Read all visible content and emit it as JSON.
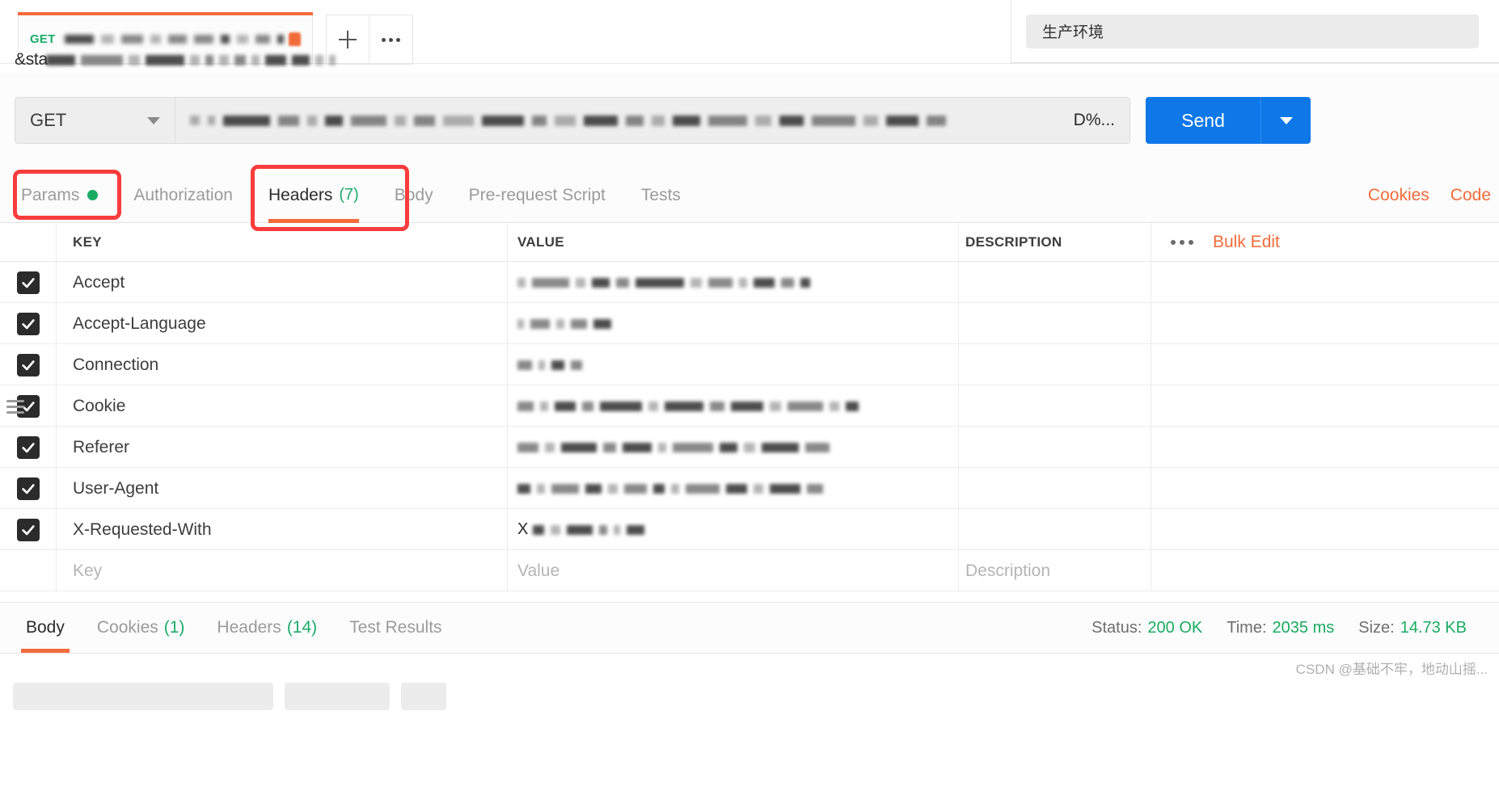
{
  "tabstrip": {
    "request_tab": {
      "method": "GET",
      "name_obscured": true
    },
    "new_tab_label": "+",
    "more_label": "•••"
  },
  "environment": {
    "selected": "生产环境"
  },
  "url_bar": {
    "method": "GET",
    "url_visible_tail": "D%...",
    "url_overflow_prefix": "&sta",
    "send_label": "Send"
  },
  "request_tabs": {
    "items": [
      {
        "label": "Params",
        "has_dot": true,
        "active": false
      },
      {
        "label": "Authorization",
        "active": false
      },
      {
        "label": "Headers",
        "count": "(7)",
        "active": true
      },
      {
        "label": "Body",
        "active": false
      },
      {
        "label": "Pre-request Script",
        "active": false
      },
      {
        "label": "Tests",
        "active": false
      }
    ],
    "right_links": [
      "Cookies",
      "Code"
    ]
  },
  "headers_table": {
    "columns": [
      "KEY",
      "VALUE",
      "DESCRIPTION"
    ],
    "bulk_edit_label": "Bulk Edit",
    "rows": [
      {
        "checked": true,
        "key": "Accept",
        "value_obscured": true,
        "description": ""
      },
      {
        "checked": true,
        "key": "Accept-Language",
        "value_obscured": true,
        "description": ""
      },
      {
        "checked": true,
        "key": "Connection",
        "value_obscured": true,
        "description": ""
      },
      {
        "checked": true,
        "key": "Cookie",
        "value_obscured": true,
        "description": "",
        "dragging": true
      },
      {
        "checked": true,
        "key": "Referer",
        "value_obscured": true,
        "description": ""
      },
      {
        "checked": true,
        "key": "User-Agent",
        "value_obscured": true,
        "description": ""
      },
      {
        "checked": true,
        "key": "X-Requested-With",
        "value_prefix": "X",
        "description": ""
      }
    ],
    "placeholder_row": {
      "key": "Key",
      "value": "Value",
      "description": "Description"
    }
  },
  "response": {
    "tabs": [
      {
        "label": "Body",
        "active": true
      },
      {
        "label": "Cookies",
        "count": "(1)",
        "active": false
      },
      {
        "label": "Headers",
        "count": "(14)",
        "active": false
      },
      {
        "label": "Test Results",
        "active": false
      }
    ],
    "status_label": "Status:",
    "status_value": "200 OK",
    "time_label": "Time:",
    "time_value": "2035 ms",
    "size_label": "Size:",
    "size_value": "14.73 KB"
  },
  "watermark": "CSDN @基础不牢，地动山摇...",
  "colors": {
    "accent_orange": "#f26b3a",
    "send_blue": "#0e78e8",
    "green": "#19ab62",
    "annotation_red": "#fa3c3c"
  }
}
